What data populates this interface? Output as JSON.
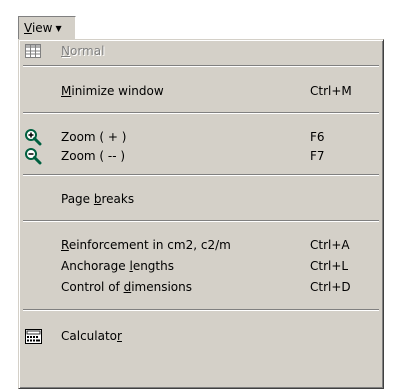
{
  "menubar": {
    "view": {
      "mnemonic": "V",
      "rest": "iew",
      "caret": "▼"
    }
  },
  "menu": {
    "normal": {
      "pre": "",
      "mn": "N",
      "post": "ormal",
      "shortcut": "",
      "icon": "grid-table-icon",
      "disabled": true
    },
    "minimize": {
      "pre": "",
      "mn": "M",
      "post": "inimize window",
      "shortcut": "Ctrl+M"
    },
    "zoom_in": {
      "pre": "Zoom ( + )",
      "mn": "",
      "post": "",
      "shortcut": "F6",
      "icon": "zoom-in-magnifier-icon"
    },
    "zoom_out": {
      "pre": "Zoom ( -- )",
      "mn": "",
      "post": "",
      "shortcut": "F7",
      "icon": "zoom-out-magnifier-icon"
    },
    "page_breaks": {
      "pre": "Page ",
      "mn": "b",
      "post": "reaks",
      "shortcut": ""
    },
    "reinforcement": {
      "pre": "",
      "mn": "R",
      "post": "einforcement in cm2, c2/m",
      "shortcut": "Ctrl+A"
    },
    "anchorage": {
      "pre": "Anchorage ",
      "mn": "l",
      "post": "engths",
      "shortcut": "Ctrl+L"
    },
    "control": {
      "pre": "Control of ",
      "mn": "d",
      "post": "imensions",
      "shortcut": "Ctrl+D"
    },
    "calculator": {
      "pre": "Calculato",
      "mn": "r",
      "post": "",
      "shortcut": "",
      "icon": "calculator-icon"
    }
  },
  "colors": {
    "menu_bg": "#d4d0c8",
    "zoom_icon": "#006040",
    "disabled_text": "#808080"
  }
}
